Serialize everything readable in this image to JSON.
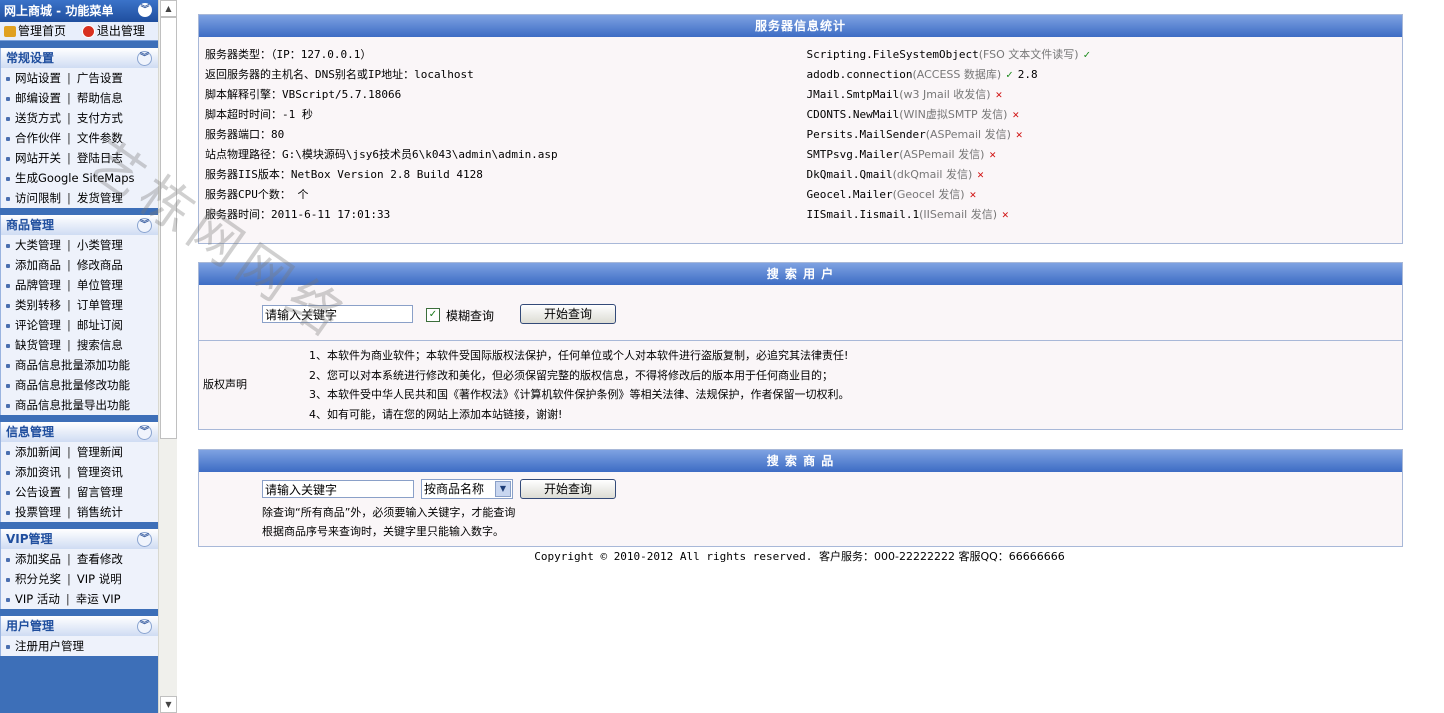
{
  "sidebar": {
    "title": "网上商城 - 功能菜单",
    "home_label": "管理首页",
    "logout_label": "退出管理",
    "groups": [
      {
        "title": "常规设置",
        "rows": [
          [
            "网站设置",
            "广告设置"
          ],
          [
            "邮编设置",
            "帮助信息"
          ],
          [
            "送货方式",
            "支付方式"
          ],
          [
            "合作伙伴",
            "文件参数"
          ],
          [
            "网站开关",
            "登陆日志"
          ],
          [
            "生成Google SiteMaps"
          ],
          [
            "访问限制",
            "发货管理"
          ]
        ]
      },
      {
        "title": "商品管理",
        "rows": [
          [
            "大类管理",
            "小类管理"
          ],
          [
            "添加商品",
            "修改商品"
          ],
          [
            "品牌管理",
            "单位管理"
          ],
          [
            "类别转移",
            "订单管理"
          ],
          [
            "评论管理",
            "邮址订阅"
          ],
          [
            "缺货管理",
            "搜索信息"
          ],
          [
            "商品信息批量添加功能"
          ],
          [
            "商品信息批量修改功能"
          ],
          [
            "商品信息批量导出功能"
          ]
        ]
      },
      {
        "title": "信息管理",
        "rows": [
          [
            "添加新闻",
            "管理新闻"
          ],
          [
            "添加资讯",
            "管理资讯"
          ],
          [
            "公告设置",
            "留言管理"
          ],
          [
            "投票管理",
            "销售统计"
          ]
        ]
      },
      {
        "title": "VIP管理",
        "rows": [
          [
            "添加奖品",
            "查看修改"
          ],
          [
            "积分兑奖",
            "VIP 说明"
          ],
          [
            "VIP 活动",
            "幸运 VIP"
          ]
        ]
      },
      {
        "title": "用户管理",
        "rows": [
          [
            "注册用户管理"
          ]
        ]
      }
    ]
  },
  "server_info": {
    "title": "服务器信息统计",
    "left": [
      "服务器类型：（IP：127.0.0.1）",
      "返回服务器的主机名、DNS别名或IP地址：localhost",
      "脚本解释引擎：VBScript/5.7.18066",
      "脚本超时时间：-1 秒",
      "服务器端口：80",
      "站点物理路径：G:\\模块源码\\jsy6技术员6\\k043\\admin\\admin.asp",
      "服务器IIS版本：NetBox Version 2.8 Build 4128",
      "服务器CPU个数： 个",
      "服务器时间：2011-6-11 17:01:33"
    ],
    "right": [
      {
        "name": "Scripting.FileSystemObject",
        "desc": "(FSO 文本文件读写)",
        "status": "✓",
        "extra": ""
      },
      {
        "name": "adodb.connection",
        "desc": "(ACCESS 数据库)",
        "status": "✓",
        "extra": "2.8"
      },
      {
        "name": "JMail.SmtpMail",
        "desc": "(w3 Jmail 收发信)",
        "status": "✕",
        "extra": ""
      },
      {
        "name": "CDONTS.NewMail",
        "desc": "(WIN虚拟SMTP 发信)",
        "status": "✕",
        "extra": ""
      },
      {
        "name": "Persits.MailSender",
        "desc": "(ASPemail 发信)",
        "status": "✕",
        "extra": ""
      },
      {
        "name": "SMTPsvg.Mailer",
        "desc": "(ASPemail 发信)",
        "status": "✕",
        "extra": ""
      },
      {
        "name": "DkQmail.Qmail",
        "desc": "(dkQmail 发信)",
        "status": "✕",
        "extra": ""
      },
      {
        "name": "Geocel.Mailer",
        "desc": "(Geocel 发信)",
        "status": "✕",
        "extra": ""
      },
      {
        "name": "IISmail.Iismail.1",
        "desc": "(IISemail 发信)",
        "status": "✕",
        "extra": ""
      }
    ]
  },
  "search_user": {
    "title": "搜 索 用 户",
    "keyword_value": "请输入关键字",
    "fuzzy_label": "模糊查询",
    "fuzzy_checked": true,
    "button_label": "开始查询"
  },
  "copyright_notice": {
    "label": "版权声明",
    "lines": [
      "1、本软件为商业软件；本软件受国际版权法保护，任何单位或个人对本软件进行盗版复制，必追究其法律责任!",
      "2、您可以对本系统进行修改和美化，但必须保留完整的版权信息，不得将修改后的版本用于任何商业目的；",
      "3、本软件受中华人民共和国《著作权法》《计算机软件保护条例》等相关法律、法规保护，作者保留一切权利。",
      "4、如有可能，请在您的网站上添加本站链接，谢谢!"
    ]
  },
  "search_goods": {
    "title": "搜 索 商 品",
    "keyword_value": "请输入关键字",
    "select_value": "按商品名称",
    "button_label": "开始查询",
    "note1": "除查询“所有商品”外，必须要输入关键字，才能查询",
    "note2": "根据商品序号来查询时，关键字里只能输入数字。"
  },
  "footer": {
    "copyright": "Copyright © 2010-2012 All rights reserved.",
    "service": "客户服务：000-22222222 客服QQ：66666666"
  },
  "watermark": "艺栋网网络",
  "colors": {
    "sidebar_bg": "#3d6fb8",
    "title_bar": "#3d6cc4",
    "ok": "#1a8a1a",
    "error": "#d01010"
  }
}
